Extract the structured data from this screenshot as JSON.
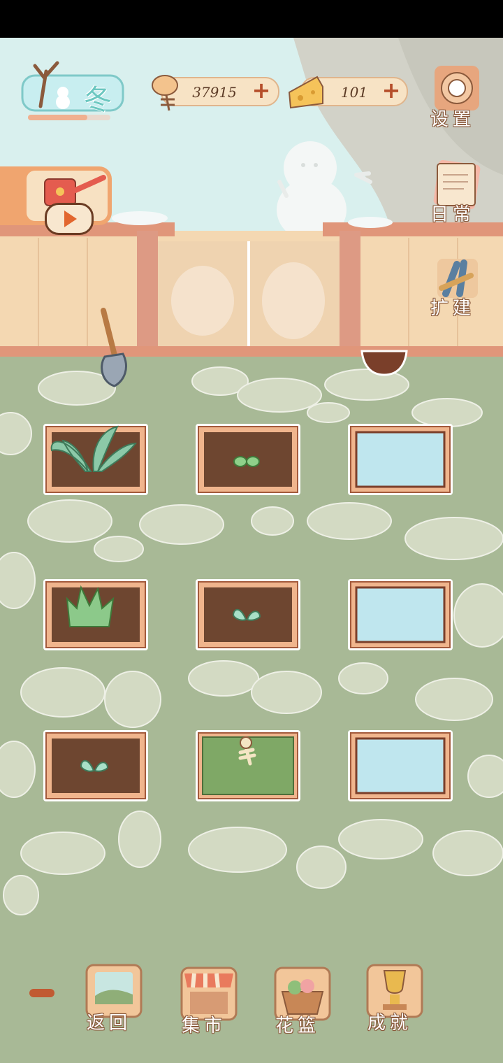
{
  "season": {
    "label": "冬",
    "progress": 0.72
  },
  "currencies": [
    {
      "name": "fish-bone",
      "value": "37915"
    },
    {
      "name": "cheese",
      "value": "101"
    }
  ],
  "side_menu": [
    {
      "name": "settings",
      "label": "设置"
    },
    {
      "name": "daily",
      "label": "日常"
    },
    {
      "name": "build",
      "label": "扩建"
    }
  ],
  "bottom_nav": [
    {
      "name": "return",
      "label": "返回"
    },
    {
      "name": "market",
      "label": "集市"
    },
    {
      "name": "flower-basket",
      "label": "花篮"
    },
    {
      "name": "achievements",
      "label": "成就"
    }
  ],
  "plots": [
    {
      "row": 1,
      "col": 1,
      "state": "large-plant"
    },
    {
      "row": 1,
      "col": 2,
      "state": "seedling"
    },
    {
      "row": 1,
      "col": 3,
      "state": "empty"
    },
    {
      "row": 2,
      "col": 1,
      "state": "bush"
    },
    {
      "row": 2,
      "col": 2,
      "state": "sprout"
    },
    {
      "row": 2,
      "col": 3,
      "state": "empty"
    },
    {
      "row": 3,
      "col": 1,
      "state": "sprout"
    },
    {
      "row": 3,
      "col": 2,
      "state": "grass-withered"
    },
    {
      "row": 3,
      "col": 3,
      "state": "empty"
    }
  ],
  "colors": {
    "grass": "#a8b996",
    "stone": "#d3dac3",
    "wall": "#f4d8b2",
    "sky": "#d9f0ee"
  }
}
